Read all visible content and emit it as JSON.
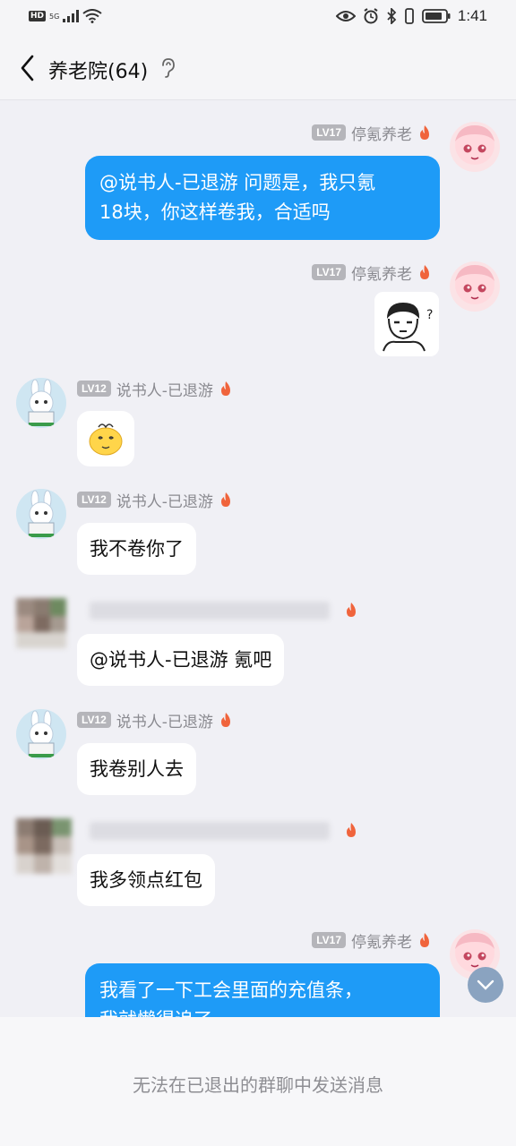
{
  "status_bar": {
    "left_badge": "HD",
    "network": "5G",
    "time": "1:41",
    "icons": [
      "signal-icon",
      "wifi-icon",
      "eye-icon",
      "alarm-icon",
      "bluetooth-icon",
      "vibrate-icon",
      "battery-icon"
    ]
  },
  "header": {
    "back_icon": "chevron-left-icon",
    "title": "养老院(64)",
    "ear_icon": "ear-icon"
  },
  "messages": [
    {
      "side": "right",
      "level": "LV17",
      "nick": "停氪养老",
      "text_lines": [
        "@说书人-已退游 问题是，我只氪",
        "18块，你这样卷我，合适吗"
      ]
    },
    {
      "side": "right",
      "level": "LV17",
      "nick": "停氪养老",
      "sticker": "confused-face-sticker"
    },
    {
      "side": "left",
      "level": "LV12",
      "nick": "说书人-已退游",
      "sticker": "dizzy-emoji"
    },
    {
      "side": "left",
      "level": "LV12",
      "nick": "说书人-已退游",
      "text": "我不卷你了"
    },
    {
      "side": "left",
      "blurred": true,
      "text": "@说书人-已退游 氪吧"
    },
    {
      "side": "left",
      "level": "LV12",
      "nick": "说书人-已退游",
      "text": "我卷别人去"
    },
    {
      "side": "left",
      "blurred": true,
      "text": "我多领点红包"
    },
    {
      "side": "right",
      "level": "LV17",
      "nick": "停氪养老",
      "text_lines": [
        "我看了一下工会里面的充值条，",
        "我就懒得追了"
      ]
    }
  ],
  "bottom": {
    "disabled_text": "无法在已退出的群聊中发送消息"
  },
  "colors": {
    "bubble_blue": "#1e9bf7",
    "background": "#f0f0f5",
    "fire_badge": "#f0643c"
  }
}
